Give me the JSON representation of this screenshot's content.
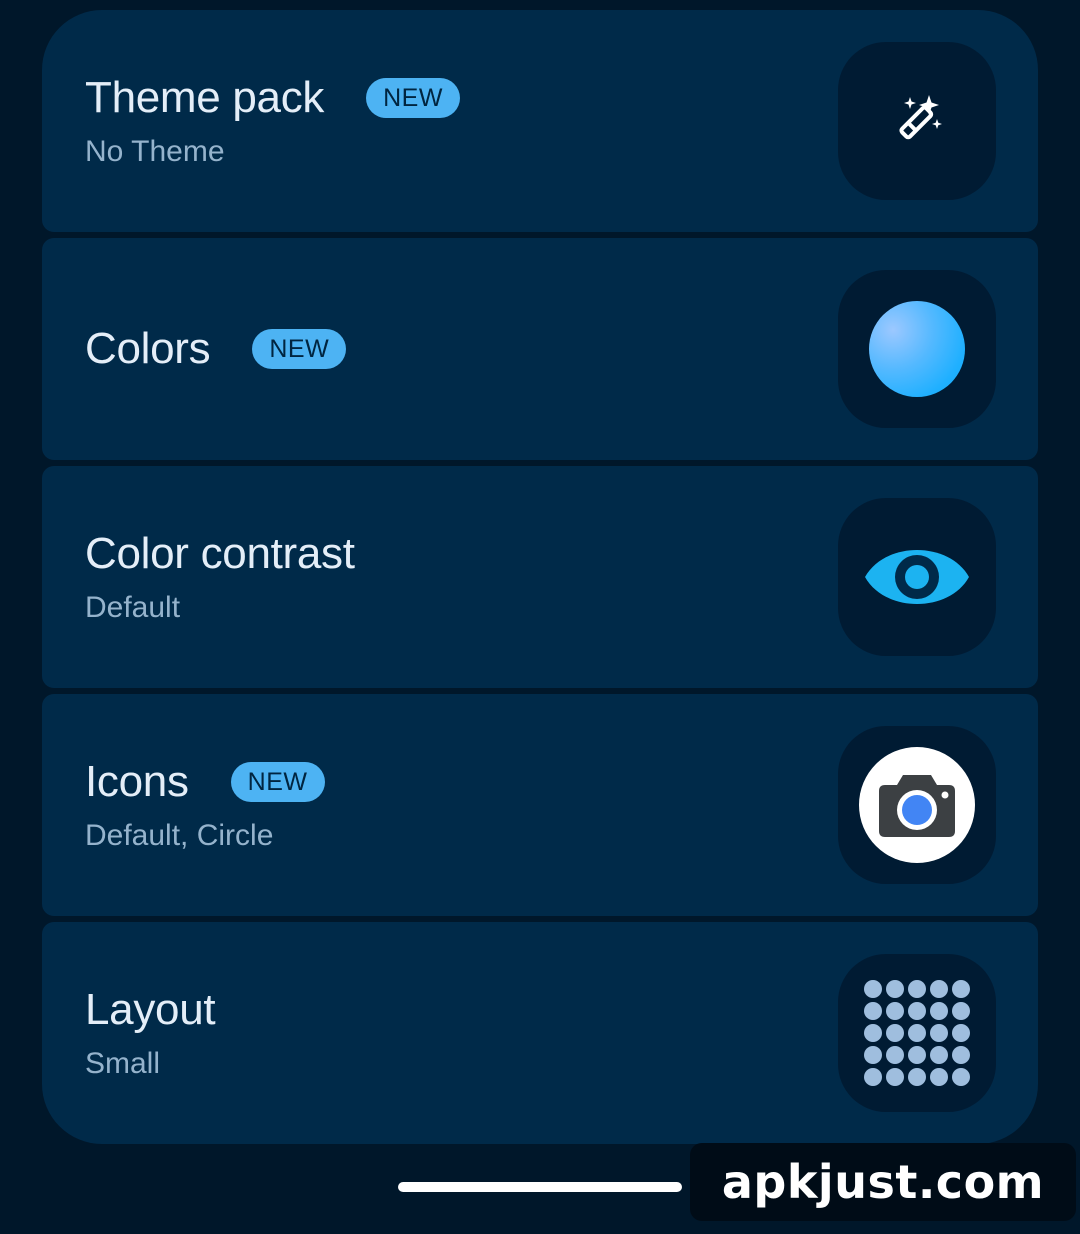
{
  "badge_text": "NEW",
  "items": [
    {
      "title": "Theme pack",
      "subtitle": "No Theme",
      "icon": "magic-wand-icon"
    },
    {
      "title": "Colors",
      "subtitle": "",
      "icon": "color-swatch-icon"
    },
    {
      "title": "Color contrast",
      "subtitle": "Default",
      "icon": "eye-icon"
    },
    {
      "title": "Icons",
      "subtitle": "Default, Circle",
      "icon": "camera-icon"
    },
    {
      "title": "Layout",
      "subtitle": "Small",
      "icon": "grid-icon"
    }
  ],
  "watermark": "apkjust.com",
  "colors": {
    "background": "#00172a",
    "card": "#002a49",
    "icon_tile": "#001b33",
    "accent": "#4db3f3",
    "title": "#e4eef8",
    "subtitle": "#95b3cc"
  }
}
